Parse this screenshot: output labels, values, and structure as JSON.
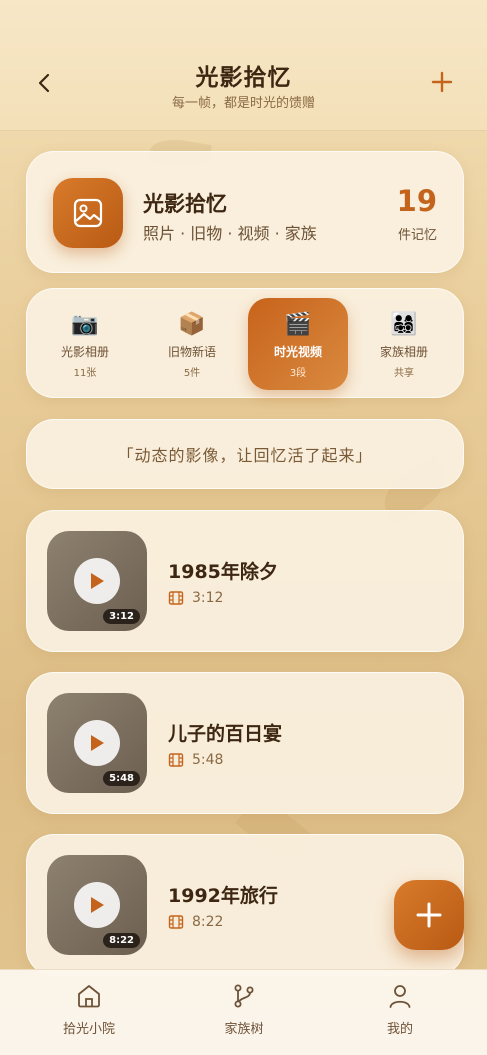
{
  "header": {
    "title": "光影拾忆",
    "subtitle": "每一帧，都是时光的馈赠",
    "back_icon": "chevron-left-icon",
    "add_icon": "plus-icon"
  },
  "summary": {
    "icon": "image-icon",
    "title": "光影拾忆",
    "tags": "照片 · 旧物 · 视频 · 家族",
    "count": "19",
    "count_unit": "件记忆"
  },
  "tabs": [
    {
      "icon": "camera-icon",
      "glyph": "📷",
      "label": "光影相册",
      "count": "11张",
      "active": false
    },
    {
      "icon": "box-icon",
      "glyph": "📦",
      "label": "旧物新语",
      "count": "5件",
      "active": false
    },
    {
      "icon": "clapper-icon",
      "glyph": "🎬",
      "label": "时光视频",
      "count": "3段",
      "active": true
    },
    {
      "icon": "family-icon",
      "glyph": "👨‍👩‍👧‍👦",
      "label": "家族相册",
      "count": "共享",
      "active": false
    }
  ],
  "quote": "「动态的影像，让回忆活了起来」",
  "videos": [
    {
      "title": "1985年除夕",
      "duration": "3:12"
    },
    {
      "title": "儿子的百日宴",
      "duration": "5:48"
    },
    {
      "title": "1992年旅行",
      "duration": "8:22"
    }
  ],
  "fab": {
    "icon": "plus-icon"
  },
  "bottom_nav": [
    {
      "icon": "home-icon",
      "label": "拾光小院"
    },
    {
      "icon": "branch-icon",
      "label": "家族树"
    },
    {
      "icon": "user-icon",
      "label": "我的"
    }
  ],
  "colors": {
    "accent": "#c4641c",
    "text_dark": "#3d2712",
    "text_muted": "#8a6a44",
    "card_bg": "#faf1e1"
  }
}
